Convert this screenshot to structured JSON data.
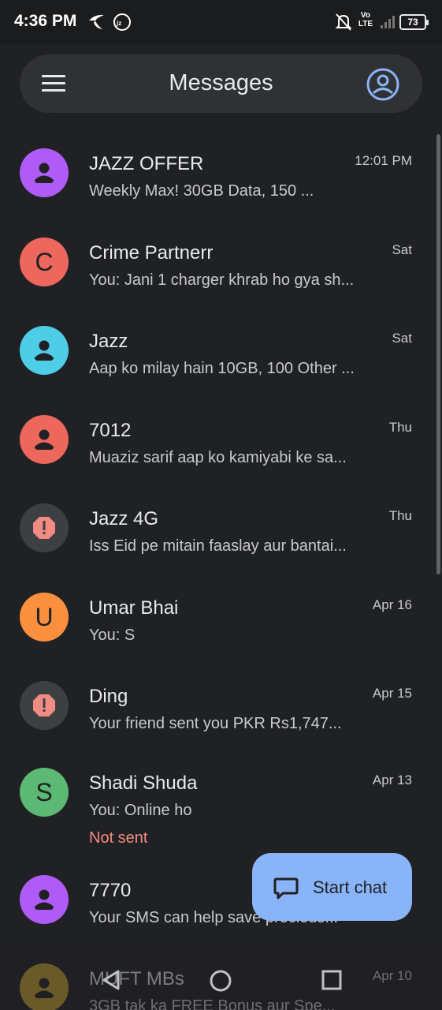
{
  "status_bar": {
    "time": "4:36 PM",
    "battery": "73",
    "volte_top": "Vo",
    "volte_bottom": "LTE",
    "icons": [
      "telenor-icon",
      "jazz-icon",
      "mute-notification-icon",
      "signal-icon",
      "battery-icon"
    ]
  },
  "header": {
    "title": "Messages",
    "menu_icon": "menu-icon",
    "account_icon": "account-icon"
  },
  "conversations": [
    {
      "name": "JAZZ OFFER",
      "snippet": "Weekly Max! 30GB Data, 150 ...",
      "time": "12:01 PM",
      "avatar": "person",
      "color": "#af5cf7"
    },
    {
      "name": "Crime Partnerr",
      "snippet": "You: Jani 1 charger khrab ho gya sh...",
      "time": "Sat",
      "avatar": "C",
      "color": "#ee675c"
    },
    {
      "name": "Jazz",
      "snippet": "Aap ko milay hain 10GB, 100 Other ...",
      "time": "Sat",
      "avatar": "person",
      "color": "#4ecde6"
    },
    {
      "name": "7012",
      "snippet": "Muaziz sarif aap ko kamiyabi ke sa...",
      "time": "Thu",
      "avatar": "person",
      "color": "#ee675c"
    },
    {
      "name": "Jazz 4G",
      "snippet": "Iss Eid pe mitain faaslay aur bantai...",
      "time": "Thu",
      "avatar": "alert",
      "color": "#3c4043"
    },
    {
      "name": "Umar Bhai",
      "snippet": "You: S",
      "time": "Apr 16",
      "avatar": "U",
      "color": "#fa903e"
    },
    {
      "name": "Ding",
      "snippet": "Your friend sent you PKR Rs1,747...",
      "time": "Apr 15",
      "avatar": "alert",
      "color": "#3c4043"
    },
    {
      "name": "Shadi Shuda",
      "snippet": "You: Online ho",
      "time": "Apr 13",
      "avatar": "S",
      "color": "#5bb974",
      "status": "Not sent"
    },
    {
      "name": "7770",
      "snippet": "Your SMS can help save precious...",
      "time": "",
      "avatar": "person",
      "color": "#af5cf7"
    },
    {
      "name": "MUFT MBs",
      "snippet": "3GB tak ka FREE Bonus aur Spe...",
      "time": "Apr 10",
      "avatar": "person",
      "color": "#c4a12a"
    }
  ],
  "fab": {
    "label": "Start chat",
    "icon": "chat-bubble-icon",
    "color": "#8ab4f8"
  },
  "navbar": {
    "icons": [
      "back-icon",
      "home-icon",
      "recents-icon"
    ]
  }
}
